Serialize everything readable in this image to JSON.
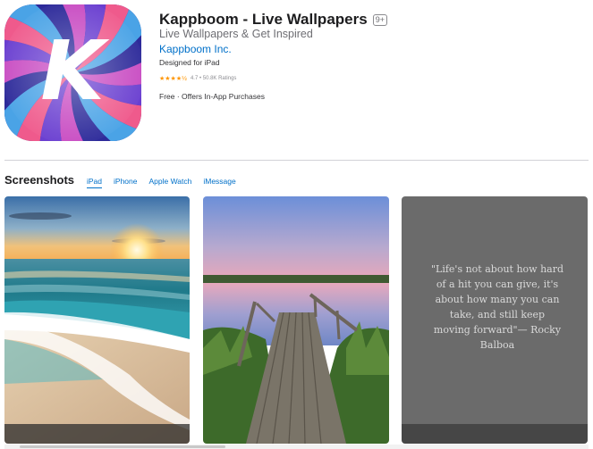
{
  "app": {
    "icon_letter": "K",
    "title": "Kappboom - Live Wallpapers",
    "age_rating": "9+",
    "subtitle": "Live Wallpapers & Get Inspired",
    "developer": "Kappboom Inc.",
    "designed_for": "Designed for iPad",
    "stars": "★★★★½",
    "rating_summary": "4.7 • 50.8K Ratings",
    "price": "Free · Offers In-App Purchases"
  },
  "screenshots": {
    "heading": "Screenshots",
    "tabs": [
      {
        "label": "iPad",
        "active": true
      },
      {
        "label": "iPhone",
        "active": false
      },
      {
        "label": "Apple Watch",
        "active": false
      },
      {
        "label": "iMessage",
        "active": false
      }
    ],
    "quote": "\"Life's not about how hard of a hit you can give, it's about how many you can take, and still keep moving forward\"— Rocky Balboa"
  },
  "colors": {
    "link": "#0070c9",
    "star": "#ff9500",
    "icon_stripes": [
      "#6a3fd0",
      "#ef5a8c",
      "#4aa3e6",
      "#2d2a9a",
      "#c84bc2"
    ]
  }
}
